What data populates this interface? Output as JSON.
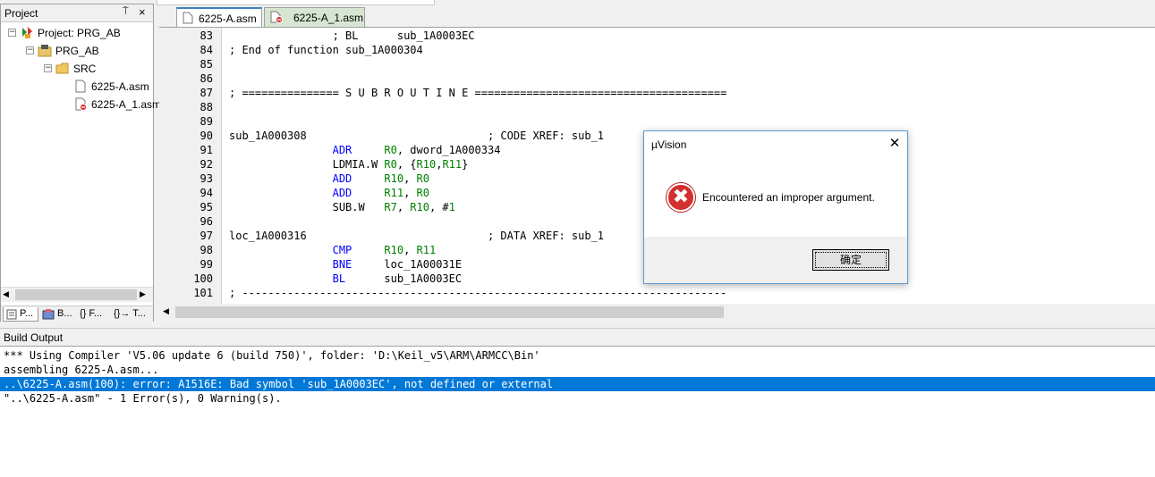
{
  "project_panel": {
    "title": "Project",
    "pin_glyph": "⍑",
    "close_glyph": "×",
    "tree": [
      {
        "label": "Project: PRG_AB",
        "expander": "−",
        "icon": "project-icon"
      },
      {
        "label": "PRG_AB",
        "expander": "−",
        "icon": "target-icon"
      },
      {
        "label": "SRC",
        "expander": "−",
        "icon": "folder-icon"
      },
      {
        "label": "6225-A.asm",
        "icon": "file-icon"
      },
      {
        "label": "6225-A_1.asm",
        "icon": "file-excluded-icon"
      }
    ],
    "tabs": [
      {
        "label": "P..."
      },
      {
        "label": "B..."
      },
      {
        "label": "{} F..."
      },
      {
        "label": "{}→ T..."
      }
    ]
  },
  "editor": {
    "tabs": [
      {
        "label": "6225-A.asm",
        "active": true
      },
      {
        "label": "6225-A_1.asm",
        "active": false
      }
    ],
    "lines": [
      {
        "num": "83",
        "parts": [
          {
            "t": "                ; BL      sub_1A0003EC",
            "c": "tx"
          }
        ]
      },
      {
        "num": "84",
        "parts": [
          {
            "t": "; End of function sub_1A000304",
            "c": "tx"
          }
        ]
      },
      {
        "num": "85",
        "parts": [
          {
            "t": "",
            "c": "tx"
          }
        ]
      },
      {
        "num": "86",
        "parts": [
          {
            "t": "",
            "c": "tx"
          }
        ]
      },
      {
        "num": "87",
        "parts": [
          {
            "t": "; =============== S U B R O U T I N E =======================================",
            "c": "tx"
          }
        ]
      },
      {
        "num": "88",
        "parts": [
          {
            "t": "",
            "c": "tx"
          }
        ]
      },
      {
        "num": "89",
        "parts": [
          {
            "t": "",
            "c": "tx"
          }
        ]
      },
      {
        "num": "90",
        "parts": [
          {
            "t": "sub_1A000308                            ; CODE XREF: sub_1",
            "c": "tx"
          }
        ]
      },
      {
        "num": "91",
        "parts": [
          {
            "t": "                ",
            "c": "tx"
          },
          {
            "t": "ADR",
            "c": "kw"
          },
          {
            "t": "     ",
            "c": "tx"
          },
          {
            "t": "R0",
            "c": "rg"
          },
          {
            "t": ", dword_1A000334",
            "c": "tx"
          }
        ]
      },
      {
        "num": "92",
        "parts": [
          {
            "t": "                LDMIA.W ",
            "c": "tx"
          },
          {
            "t": "R0",
            "c": "rg"
          },
          {
            "t": ", {",
            "c": "tx"
          },
          {
            "t": "R10",
            "c": "rg"
          },
          {
            "t": ",",
            "c": "tx"
          },
          {
            "t": "R11",
            "c": "rg"
          },
          {
            "t": "}",
            "c": "tx"
          }
        ]
      },
      {
        "num": "93",
        "parts": [
          {
            "t": "                ",
            "c": "tx"
          },
          {
            "t": "ADD",
            "c": "kw"
          },
          {
            "t": "     ",
            "c": "tx"
          },
          {
            "t": "R10",
            "c": "rg"
          },
          {
            "t": ", ",
            "c": "tx"
          },
          {
            "t": "R0",
            "c": "rg"
          }
        ]
      },
      {
        "num": "94",
        "parts": [
          {
            "t": "                ",
            "c": "tx"
          },
          {
            "t": "ADD",
            "c": "kw"
          },
          {
            "t": "     ",
            "c": "tx"
          },
          {
            "t": "R11",
            "c": "rg"
          },
          {
            "t": ", ",
            "c": "tx"
          },
          {
            "t": "R0",
            "c": "rg"
          }
        ]
      },
      {
        "num": "95",
        "parts": [
          {
            "t": "                SUB.W   ",
            "c": "tx"
          },
          {
            "t": "R7",
            "c": "rg"
          },
          {
            "t": ", ",
            "c": "tx"
          },
          {
            "t": "R10",
            "c": "rg"
          },
          {
            "t": ", #",
            "c": "tx"
          },
          {
            "t": "1",
            "c": "rg"
          }
        ]
      },
      {
        "num": "96",
        "parts": [
          {
            "t": "",
            "c": "tx"
          }
        ]
      },
      {
        "num": "97",
        "parts": [
          {
            "t": "loc_1A000316                            ; DATA XREF: sub_1",
            "c": "tx"
          }
        ]
      },
      {
        "num": "98",
        "parts": [
          {
            "t": "                ",
            "c": "tx"
          },
          {
            "t": "CMP",
            "c": "kw"
          },
          {
            "t": "     ",
            "c": "tx"
          },
          {
            "t": "R10",
            "c": "rg"
          },
          {
            "t": ", ",
            "c": "tx"
          },
          {
            "t": "R11",
            "c": "rg"
          }
        ]
      },
      {
        "num": "99",
        "parts": [
          {
            "t": "                ",
            "c": "tx"
          },
          {
            "t": "BNE",
            "c": "kw"
          },
          {
            "t": "     loc_1A00031E",
            "c": "tx"
          }
        ]
      },
      {
        "num": "100",
        "parts": [
          {
            "t": "                ",
            "c": "tx"
          },
          {
            "t": "BL",
            "c": "kw"
          },
          {
            "t": "      sub_1A0003EC",
            "c": "tx"
          }
        ]
      },
      {
        "num": "101",
        "parts": [
          {
            "t": "; ---------------------------------------------------------------------------",
            "c": "tx"
          }
        ]
      }
    ]
  },
  "build_output": {
    "title": "Build Output",
    "lines": [
      {
        "text": "*** Using Compiler 'V5.06 update 6 (build 750)', folder: 'D:\\Keil_v5\\ARM\\ARMCC\\Bin'",
        "selected": false
      },
      {
        "text": "assembling 6225-A.asm...",
        "selected": false
      },
      {
        "text": "..\\6225-A.asm(100): error: A1516E: Bad symbol 'sub_1A0003EC', not defined or external",
        "selected": true
      },
      {
        "text": "\"..\\6225-A.asm\" - 1 Error(s), 0 Warning(s).",
        "selected": false
      }
    ]
  },
  "dialog": {
    "title": "µVision",
    "close_glyph": "✕",
    "icon": "error-icon",
    "icon_glyph": "✖",
    "message": "Encountered an improper argument.",
    "ok_label": "确定"
  },
  "colors": {
    "selection": "#0078d7",
    "keyword": "#0000ff",
    "register": "#008000",
    "error_red": "#d32f2f"
  }
}
